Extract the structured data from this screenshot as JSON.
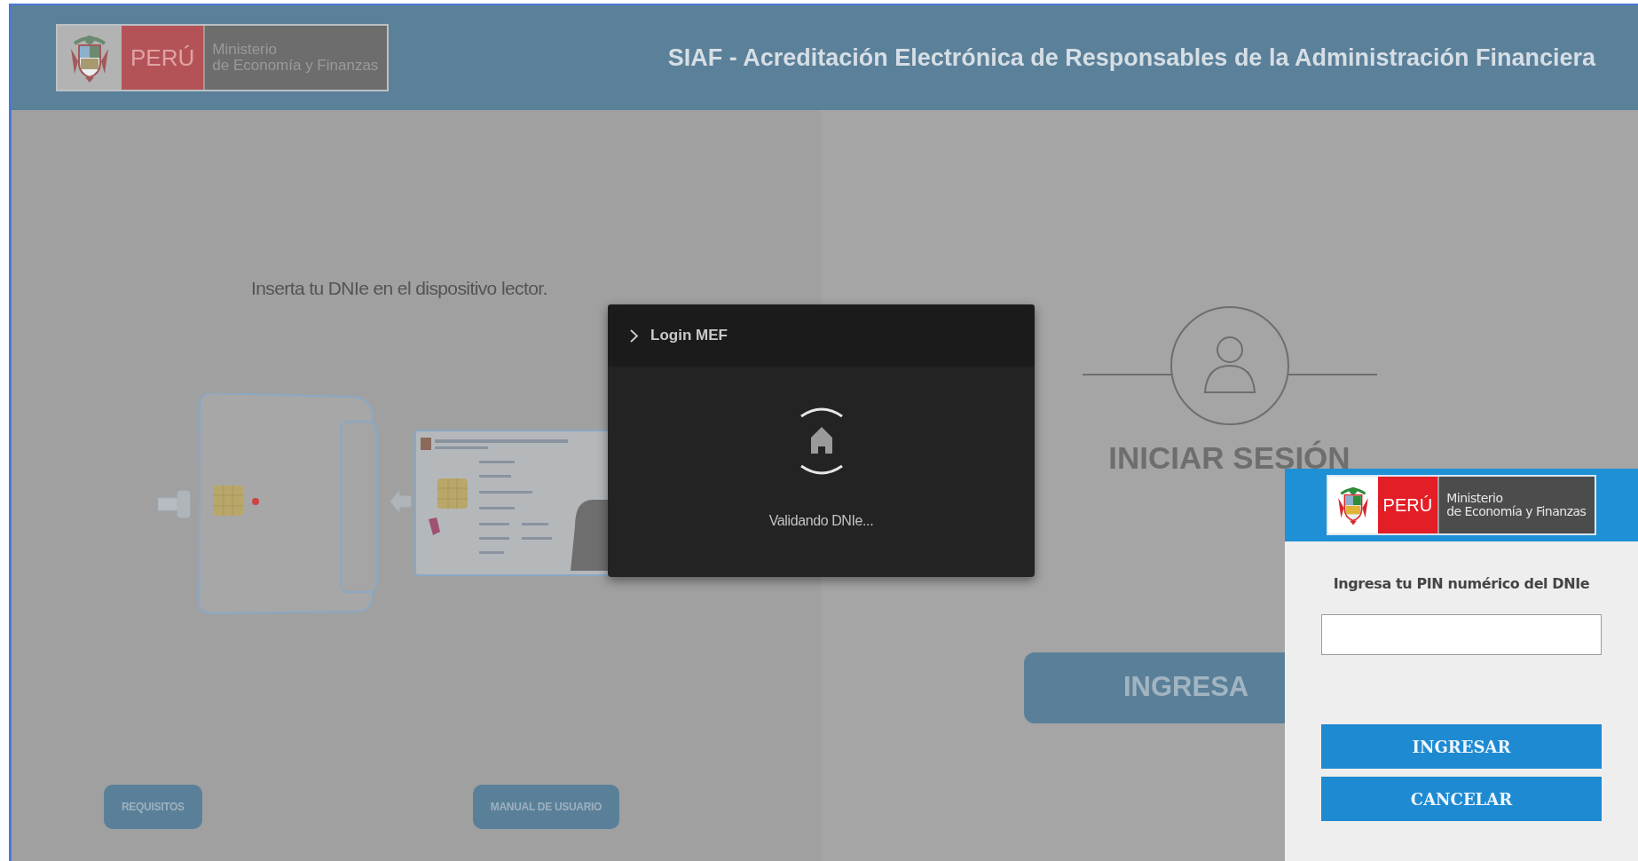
{
  "header": {
    "logo": {
      "country": "PERÚ",
      "ministry_line1": "Ministerio",
      "ministry_line2": "de Economía y Finanzas"
    },
    "title": "SIAF - Acreditación Electrónica de Responsables de la Administración Financiera"
  },
  "left_panel": {
    "instruction": "Inserta tu DNIe en el dispositivo lector.",
    "buttons": [
      "REQUISITOS",
      "MANUAL DE USUARIO"
    ]
  },
  "right_panel": {
    "heading": "INICIAR SESIÓN",
    "button": "INGRESA"
  },
  "modal": {
    "title": "Login MEF",
    "message": "Validando DNIe..."
  },
  "pin_dialog": {
    "logo": {
      "country": "PERÚ",
      "ministry_line1": "Ministerio",
      "ministry_line2": "de Economía y Finanzas"
    },
    "label": "Ingresa tu PIN numérico del DNIe",
    "buttons": [
      "INGRESAR",
      "CANCELAR"
    ]
  }
}
